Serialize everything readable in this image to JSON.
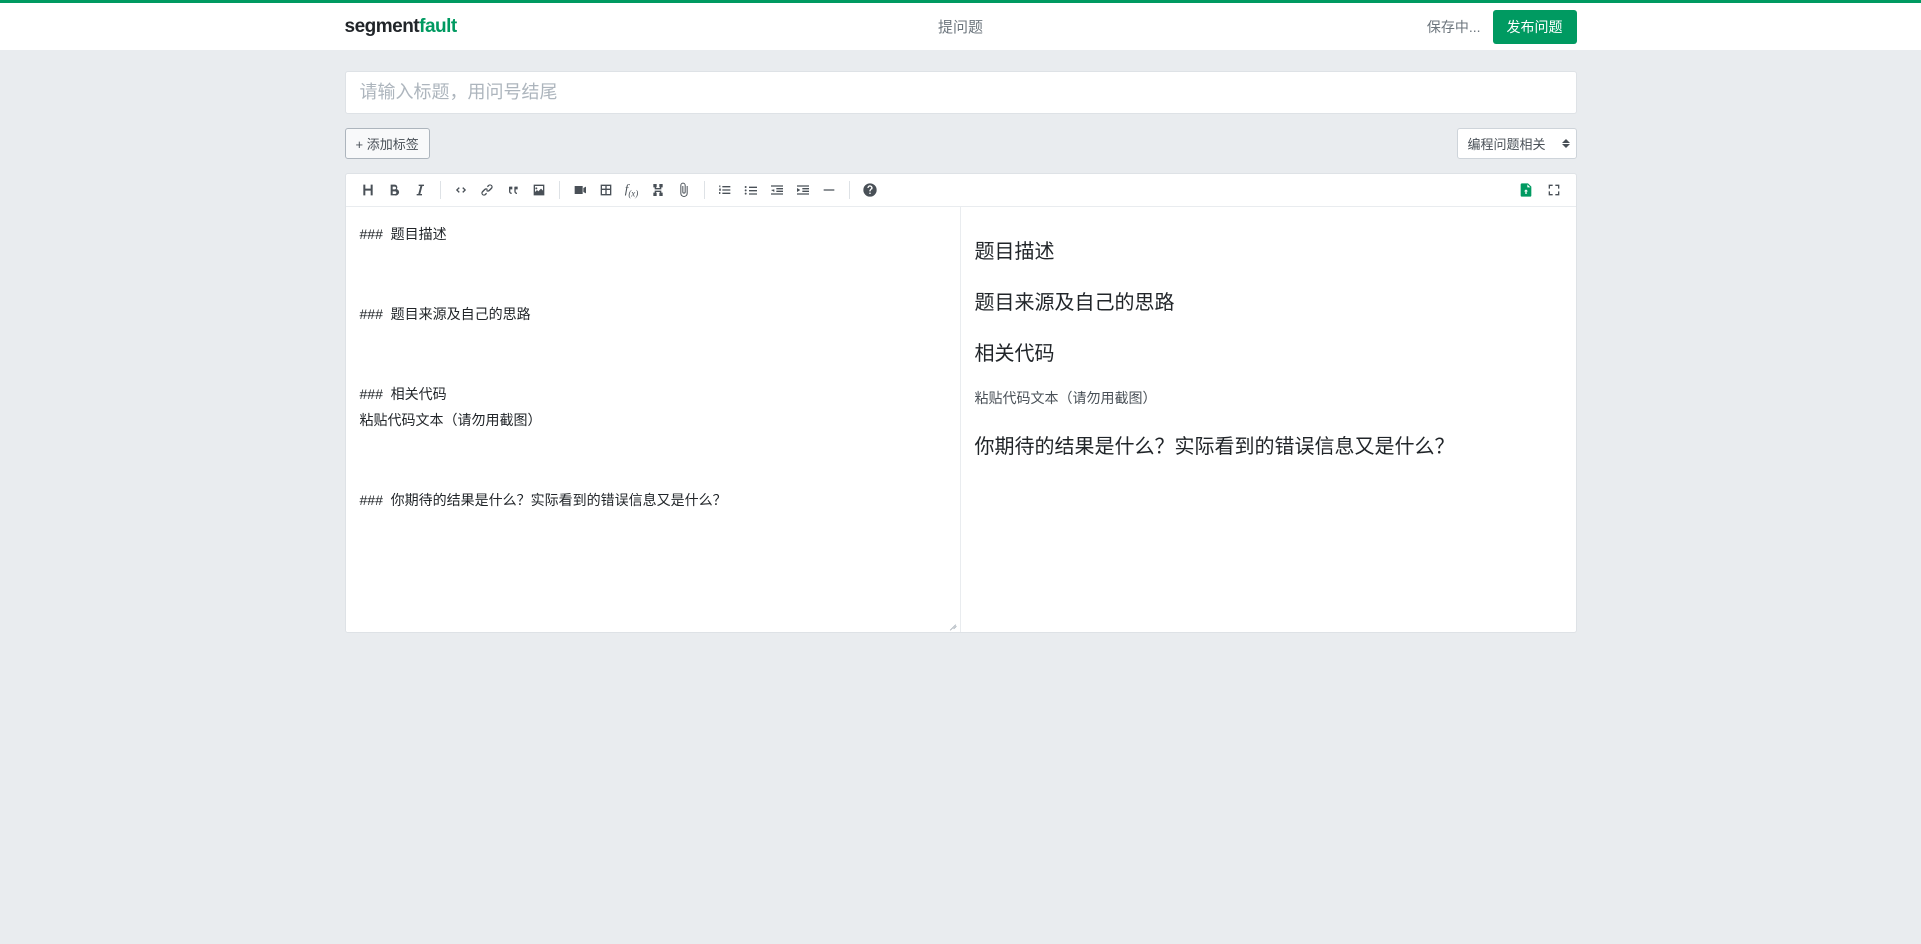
{
  "header": {
    "logo_seg": "segment",
    "logo_fault": "fault",
    "page_title": "提问题",
    "saving_text": "保存中...",
    "publish_label": "发布问题"
  },
  "title_input": {
    "placeholder": "请输入标题，用问号结尾",
    "value": ""
  },
  "tags": {
    "add_label": "+ 添加标签"
  },
  "category": {
    "selected": "编程问题相关"
  },
  "editor": {
    "source_text": "###  题目描述\n\n\n###  题目来源及自己的思路\n\n\n###  相关代码\n粘贴代码文本（请勿用截图）\n\n\n###  你期待的结果是什么？实际看到的错误信息又是什么？"
  },
  "preview": {
    "h1": "题目描述",
    "h2": "题目来源及自己的思路",
    "h3": "相关代码",
    "p3": "粘贴代码文本（请勿用截图）",
    "h4": "你期待的结果是什么？实际看到的错误信息又是什么？"
  }
}
